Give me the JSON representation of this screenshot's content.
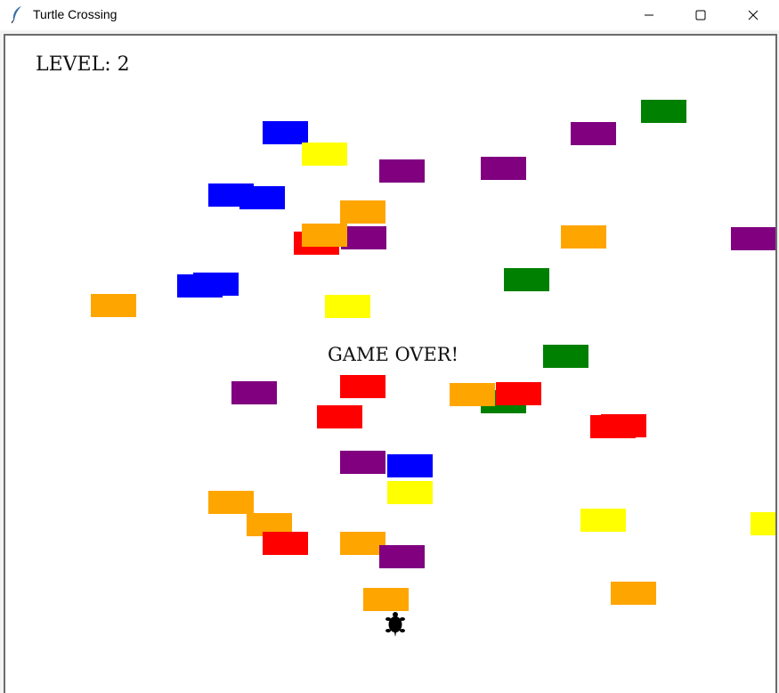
{
  "window": {
    "title": "Turtle Crossing",
    "icons": [
      "feather-icon",
      "minimize-icon",
      "maximize-icon",
      "close-icon"
    ]
  },
  "game": {
    "level_text": "LEVEL: 2",
    "status_text": "GAME OVER!",
    "colors": {
      "red": "#ff0000",
      "orange": "#ffa500",
      "yellow": "#ffff00",
      "green": "#008000",
      "blue": "#0000ff",
      "purple": "#800080"
    }
  }
}
